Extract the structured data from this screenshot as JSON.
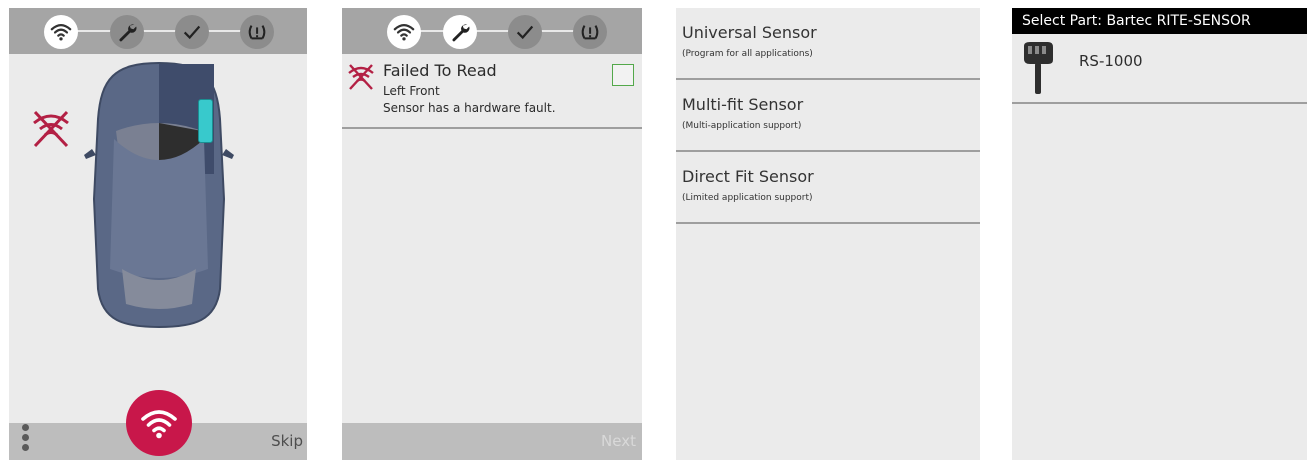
{
  "screen1": {
    "steps": [
      {
        "icon": "wifi-icon",
        "active": true
      },
      {
        "icon": "wrench-icon",
        "active": false
      },
      {
        "icon": "check-icon",
        "active": false
      },
      {
        "icon": "tpms-warning-icon",
        "active": false
      }
    ],
    "skip_label": "Skip"
  },
  "screen2": {
    "fault": {
      "title": "Failed To Read",
      "location": "Left Front",
      "message": "Sensor has a hardware fault."
    },
    "next_label": "Next"
  },
  "screen3": {
    "options": [
      {
        "title": "Universal Sensor",
        "subtitle": "(Program for all applications)"
      },
      {
        "title": "Multi-fit Sensor",
        "subtitle": "(Multi-application support)"
      },
      {
        "title": "Direct Fit Sensor",
        "subtitle": "(Limited application support)"
      }
    ]
  },
  "screen4": {
    "header": "Select Part: Bartec RITE-SENSOR",
    "parts": [
      {
        "label": "RS-1000"
      }
    ]
  },
  "colors": {
    "accent": "#c8174a",
    "active_sensor": "#38c9cc",
    "checkbox_border": "#53a84a",
    "bar": "#a5a5a5"
  }
}
